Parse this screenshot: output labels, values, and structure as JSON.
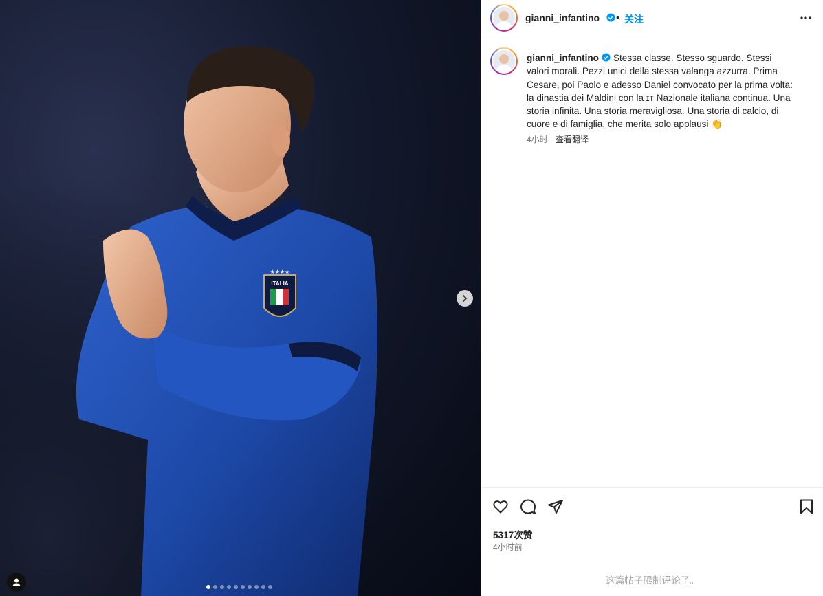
{
  "post": {
    "username": "gianni_infantino",
    "follow_label": "关注",
    "bullet": "•",
    "caption_text": "Stessa classe. Stesso sguardo. Stessi valori morali. Pezzi unici della stessa valanga azzurra. Prima Cesare, poi Paolo e adesso Daniel convocato per la prima volta: la dinastia dei Maldini con la ɪᴛ Nazionale italiana continua. Una storia infinita. Una storia meravigliosa. Una storia di calcio, di cuore e di famiglia, che merita solo applausi 👏",
    "caption_time": "4小时",
    "translate_label": "查看翻译",
    "likes": "5317次赞",
    "time": "4小时前",
    "comments_disabled": "这篇帖子限制评论了。"
  },
  "media": {
    "carousel_total": 10,
    "carousel_active": 0,
    "jersey_badge": "ITALIA"
  },
  "icons": {
    "verified": "verified-badge-icon",
    "more": "more-options-icon",
    "like": "heart-icon",
    "comment": "comment-icon",
    "share": "share-icon",
    "save": "bookmark-icon",
    "next": "chevron-right-icon",
    "tags": "user-tag-icon"
  },
  "colors": {
    "accent": "#0095f6",
    "verified": "#0095f6",
    "text": "#262626",
    "secondary": "#737373",
    "muted": "#a8a8a8",
    "jersey_blue": "#1f4fb5"
  }
}
